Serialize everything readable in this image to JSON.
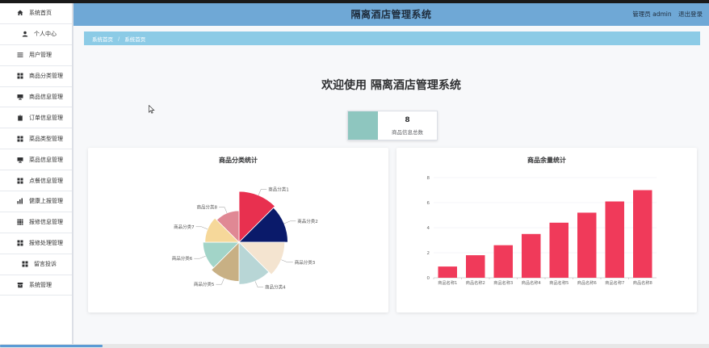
{
  "header": {
    "title": "隔离酒店管理系统",
    "user_label": "管理员 admin",
    "logout_label": "退出登录"
  },
  "sidebar": {
    "items": [
      {
        "label": "系统首页",
        "icon": "home-icon"
      },
      {
        "label": "个人中心",
        "icon": "user-icon"
      },
      {
        "label": "用户管理",
        "icon": "list-icon"
      },
      {
        "label": "商品分类管理",
        "icon": "grid-icon"
      },
      {
        "label": "商品信息管理",
        "icon": "monitor-icon"
      },
      {
        "label": "订单信息管理",
        "icon": "clipboard-icon"
      },
      {
        "label": "菜品类型管理",
        "icon": "grid-icon"
      },
      {
        "label": "菜品信息管理",
        "icon": "monitor-icon"
      },
      {
        "label": "点餐信息管理",
        "icon": "grid-icon"
      },
      {
        "label": "健康上报管理",
        "icon": "chart-icon"
      },
      {
        "label": "报修信息管理",
        "icon": "apps-icon"
      },
      {
        "label": "报修处理管理",
        "icon": "grid-icon"
      },
      {
        "label": "留言投诉",
        "icon": "grid-icon"
      },
      {
        "label": "系统管理",
        "icon": "folder-icon"
      }
    ]
  },
  "breadcrumb": {
    "items": [
      "系统首页",
      "系统首页"
    ],
    "separator": "/"
  },
  "welcome": "欢迎使用 隔离酒店管理系统",
  "stat": {
    "value": "8",
    "label": "商品信息总数",
    "color": "#8ec6bf"
  },
  "colors": {
    "header_bg": "#6fa8d6",
    "breadcrumb_bg": "#8ccbe6",
    "bar": "#f03a5a"
  },
  "chart_data": [
    {
      "type": "pie",
      "title": "商品分类统计",
      "categories": [
        "商品分类1",
        "商品分类2",
        "商品分类3",
        "商品分类4",
        "商品分类5",
        "商品分类6",
        "商品分类7",
        "商品分类8"
      ],
      "values": [
        10,
        10,
        10,
        10,
        10,
        10,
        10,
        10
      ],
      "radii": [
        1.0,
        0.96,
        0.9,
        0.83,
        0.77,
        0.71,
        0.67,
        0.62
      ],
      "colors": [
        "#e8304f",
        "#0a1a6a",
        "#f4e4d0",
        "#b8d6d6",
        "#c8b084",
        "#a2d4c8",
        "#f6d89a",
        "#e08894"
      ]
    },
    {
      "type": "bar",
      "title": "商品余量统计",
      "categories": [
        "商品名称1",
        "商品名称2",
        "商品名称3",
        "商品名称4",
        "商品名称5",
        "商品名称6",
        "商品名称7",
        "商品名称8"
      ],
      "values": [
        0.9,
        1.8,
        2.6,
        3.5,
        4.4,
        5.2,
        6.1,
        7.0
      ],
      "ylim": [
        0,
        8
      ],
      "yticks": [
        0,
        2,
        4,
        6,
        8
      ],
      "grid": true
    }
  ]
}
